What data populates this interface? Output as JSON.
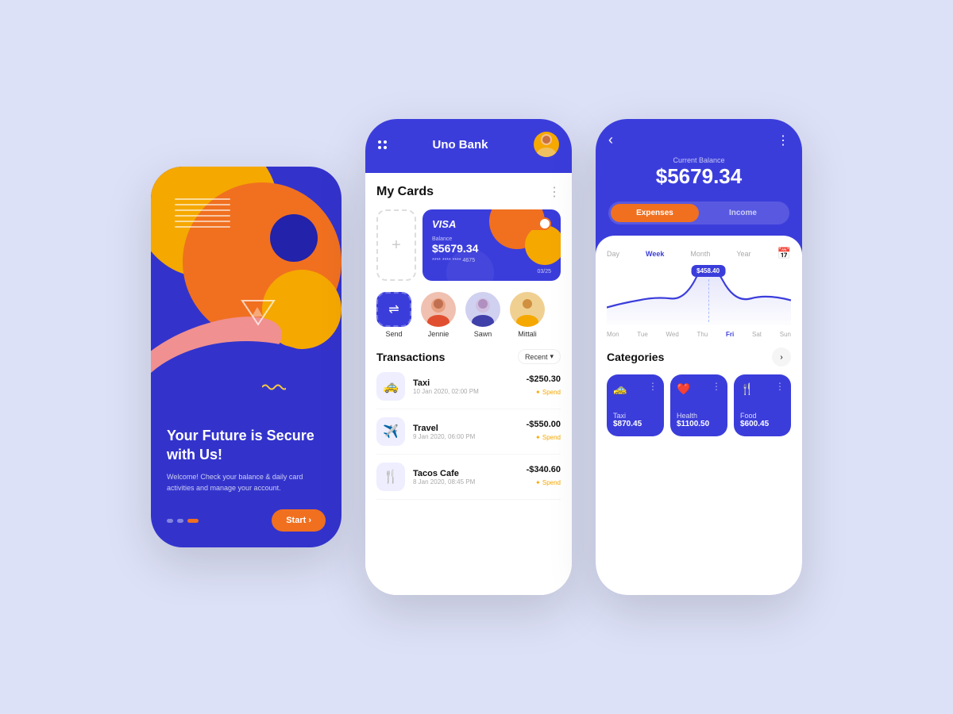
{
  "background": "#dde1f7",
  "phone1": {
    "headline": "Your Future is Secure with Us!",
    "subtitle": "Welcome! Check your balance & daily card activities and manage your account.",
    "start_label": "Start ›",
    "dots": [
      "inactive",
      "inactive",
      "active"
    ]
  },
  "phone2": {
    "header": {
      "title": "Uno Bank"
    },
    "my_cards": {
      "title": "My Cards",
      "add_label": "+"
    },
    "visa_card": {
      "type": "VISA",
      "balance_label": "Balance",
      "balance": "$5679.34",
      "number": "**** **** **** 4675",
      "expiry": "03/25"
    },
    "people": [
      {
        "name": "Send",
        "type": "send"
      },
      {
        "name": "Jennie",
        "type": "avatar"
      },
      {
        "name": "Sawn",
        "type": "avatar"
      },
      {
        "name": "Mittali",
        "type": "avatar"
      }
    ],
    "transactions": {
      "title": "Transactions",
      "filter": "Recent",
      "items": [
        {
          "name": "Taxi",
          "date": "10 Jan 2020, 02:00 PM",
          "amount": "-$250.30",
          "type": "Spend",
          "icon": "🚕"
        },
        {
          "name": "Travel",
          "date": "9 Jan 2020, 06:00 PM",
          "amount": "-$550.00",
          "type": "Spend",
          "icon": "✈️"
        },
        {
          "name": "Tacos Cafe",
          "date": "8 Jan 2020, 08:45 PM",
          "amount": "-$340.60",
          "type": "Spend",
          "icon": "🍴"
        }
      ]
    }
  },
  "phone3": {
    "balance_label": "Current Balance",
    "balance": "$5679.34",
    "tabs": [
      "Expenses",
      "Income"
    ],
    "active_tab": "Expenses",
    "chart": {
      "days": [
        "Mon",
        "Tue",
        "Wed",
        "Thu",
        "Fri",
        "Sat",
        "Sun"
      ],
      "active_day": "Fri",
      "tooltip": "$458.40"
    },
    "categories": {
      "title": "Categories",
      "items": [
        {
          "name": "Taxi",
          "amount": "$870.45",
          "icon": "🚕"
        },
        {
          "name": "Health",
          "amount": "$1100.50",
          "icon": "❤️"
        },
        {
          "name": "Food",
          "amount": "$600.45",
          "icon": "🍴"
        }
      ]
    }
  }
}
